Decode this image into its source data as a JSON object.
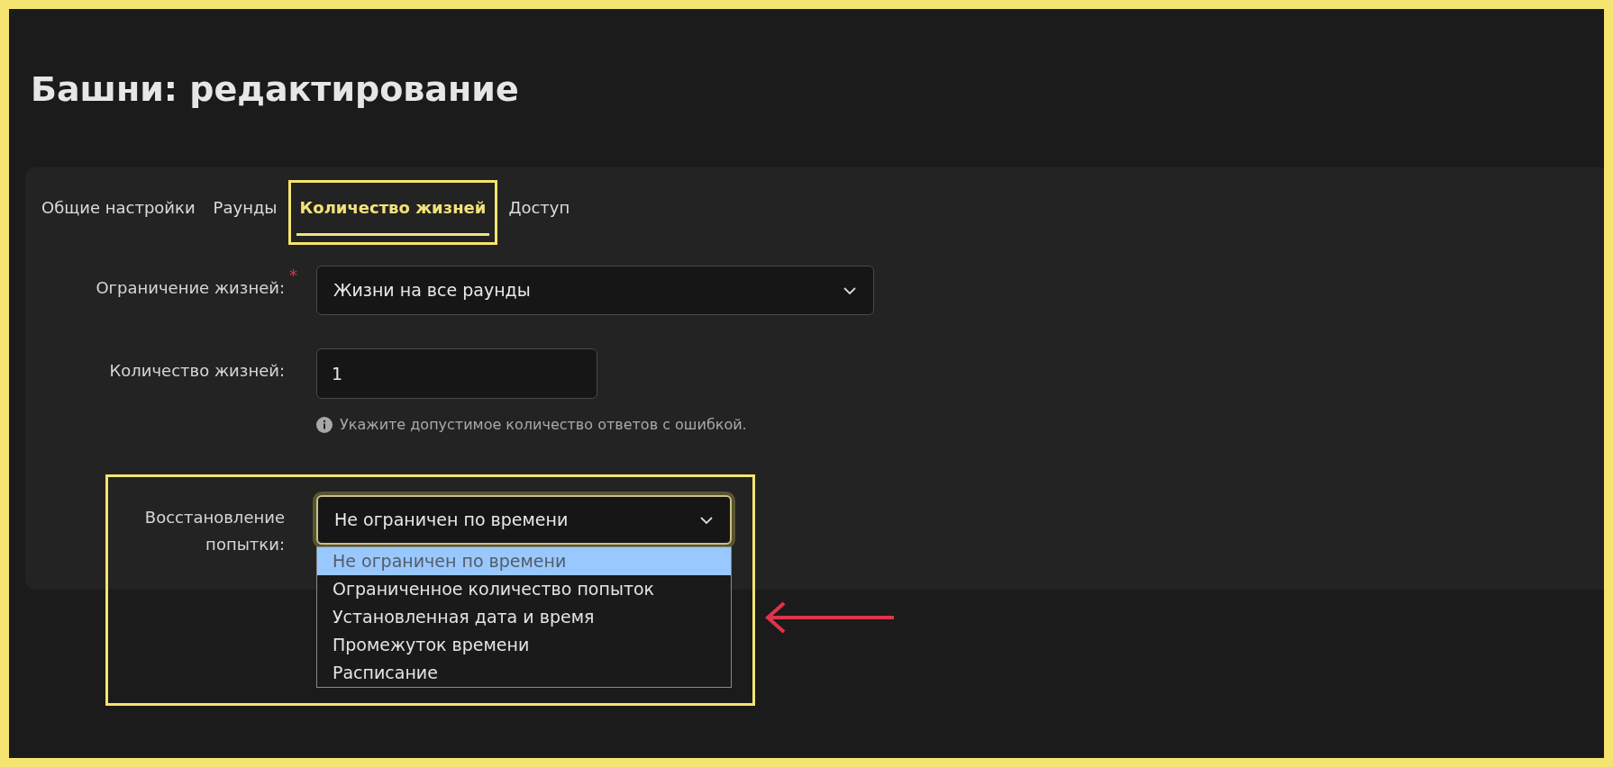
{
  "page": {
    "title": "Башни: редактирование"
  },
  "tabs": [
    {
      "label": "Общие настройки",
      "selected": false
    },
    {
      "label": "Раунды",
      "selected": false
    },
    {
      "label": "Количество жизней",
      "selected": true
    },
    {
      "label": "Доступ",
      "selected": false
    }
  ],
  "fields": [
    {
      "kind": "select",
      "label": "Ограничение жизней:",
      "required_mark": "*",
      "value": "Жизни на все раунды",
      "open": false
    },
    {
      "kind": "input",
      "label": "Количество жизней:",
      "value": "1",
      "hint": "Укажите допустимое количество ответов с ошибкой."
    },
    {
      "kind": "select",
      "label": "Восстановление попытки:",
      "value": "Не ограничен по времени",
      "open": true,
      "options": [
        {
          "label": "Не ограничен по времени",
          "selected": true
        },
        {
          "label": "Ограниченное количество попыток",
          "selected": false
        },
        {
          "label": "Установленная дата и время",
          "selected": false
        },
        {
          "label": "Промежуток времени",
          "selected": false
        },
        {
          "label": "Расписание",
          "selected": false
        }
      ]
    }
  ]
}
